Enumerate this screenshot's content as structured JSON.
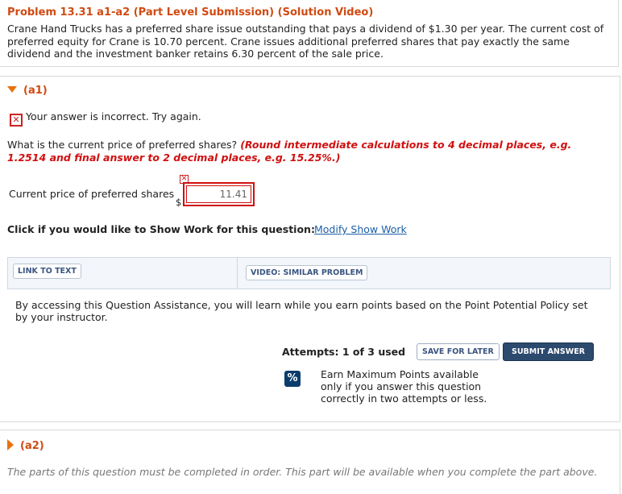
{
  "problem": {
    "title": "Problem 13.31 a1-a2 (Part Level Submission) (Solution Video)",
    "text": "Crane Hand Trucks has a preferred share issue outstanding that pays a dividend of $1.30 per year. The current cost of preferred equity for Crane is 10.70 percent. Crane issues additional preferred shares that pay exactly the same dividend and the investment banker retains 6.30 percent of the sale price."
  },
  "part_a1": {
    "label": "(a1)",
    "feedback": "Your answer is incorrect.  Try again.",
    "question": "What is the current price of preferred shares?",
    "hint": "(Round intermediate calculations to 4 decimal places, e.g. 1.2514 and final answer to 2 decimal places, e.g. 15.25%.)",
    "answer_label": "Current price of preferred shares",
    "currency": "$",
    "answer_value": "11.41",
    "show_work_prompt": "Click if you would like to Show Work for this question:",
    "show_work_link": "Modify Show Work",
    "link_to_text": "LINK TO TEXT",
    "video_similar": "VIDEO: SIMILAR PROBLEM",
    "assist_note": "By accessing this Question Assistance, you will learn while you earn points based on the Point Potential Policy set by your instructor.",
    "attempts": "Attempts: 1 of 3 used",
    "save_label": "SAVE FOR LATER",
    "submit_label": "SUBMIT ANSWER",
    "pct_icon": "%",
    "earn_text": "Earn Maximum Points available only if you answer this question correctly in two attempts or less."
  },
  "part_a2": {
    "label": "(a2)",
    "note": "The parts of this question must be completed in order. This part will be available when you complete the part above."
  },
  "colors": {
    "accent": "#d14a12",
    "error": "#d01010",
    "link": "#1d5fa6",
    "submit_bg": "#2c4a6e"
  }
}
